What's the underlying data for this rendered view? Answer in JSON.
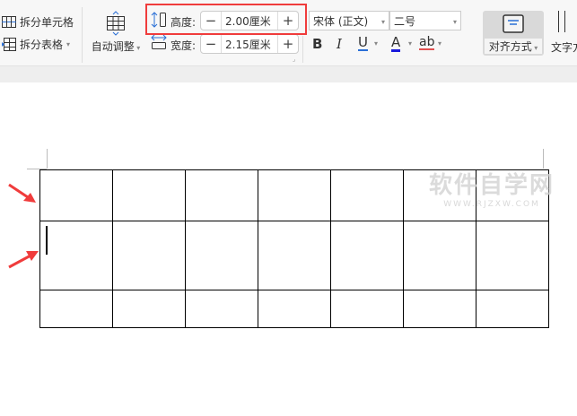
{
  "toolbar": {
    "split_cells": "拆分单元格",
    "split_table": "拆分表格",
    "auto_adjust": "自动调整",
    "height_label": "高度:",
    "height_value": "2.00厘米",
    "width_label": "宽度:",
    "width_value": "2.15厘米",
    "minus": "−",
    "plus": "+",
    "font_name": "宋体 (正文)",
    "font_size": "二号",
    "bold": "B",
    "italic": "I",
    "underline": "U",
    "font_color": "A",
    "highlight": "ab",
    "align": "对齐方式",
    "text_direction": "文字方"
  },
  "watermark": {
    "line1": "软件自学网",
    "line2": "WWW.RJZXW.COM"
  },
  "table": {
    "rows": 3,
    "cols": 7
  },
  "colors": {
    "highlight_box": "#f03c3c",
    "arrow": "#f03c3c",
    "accent": "#2a6fd6"
  }
}
